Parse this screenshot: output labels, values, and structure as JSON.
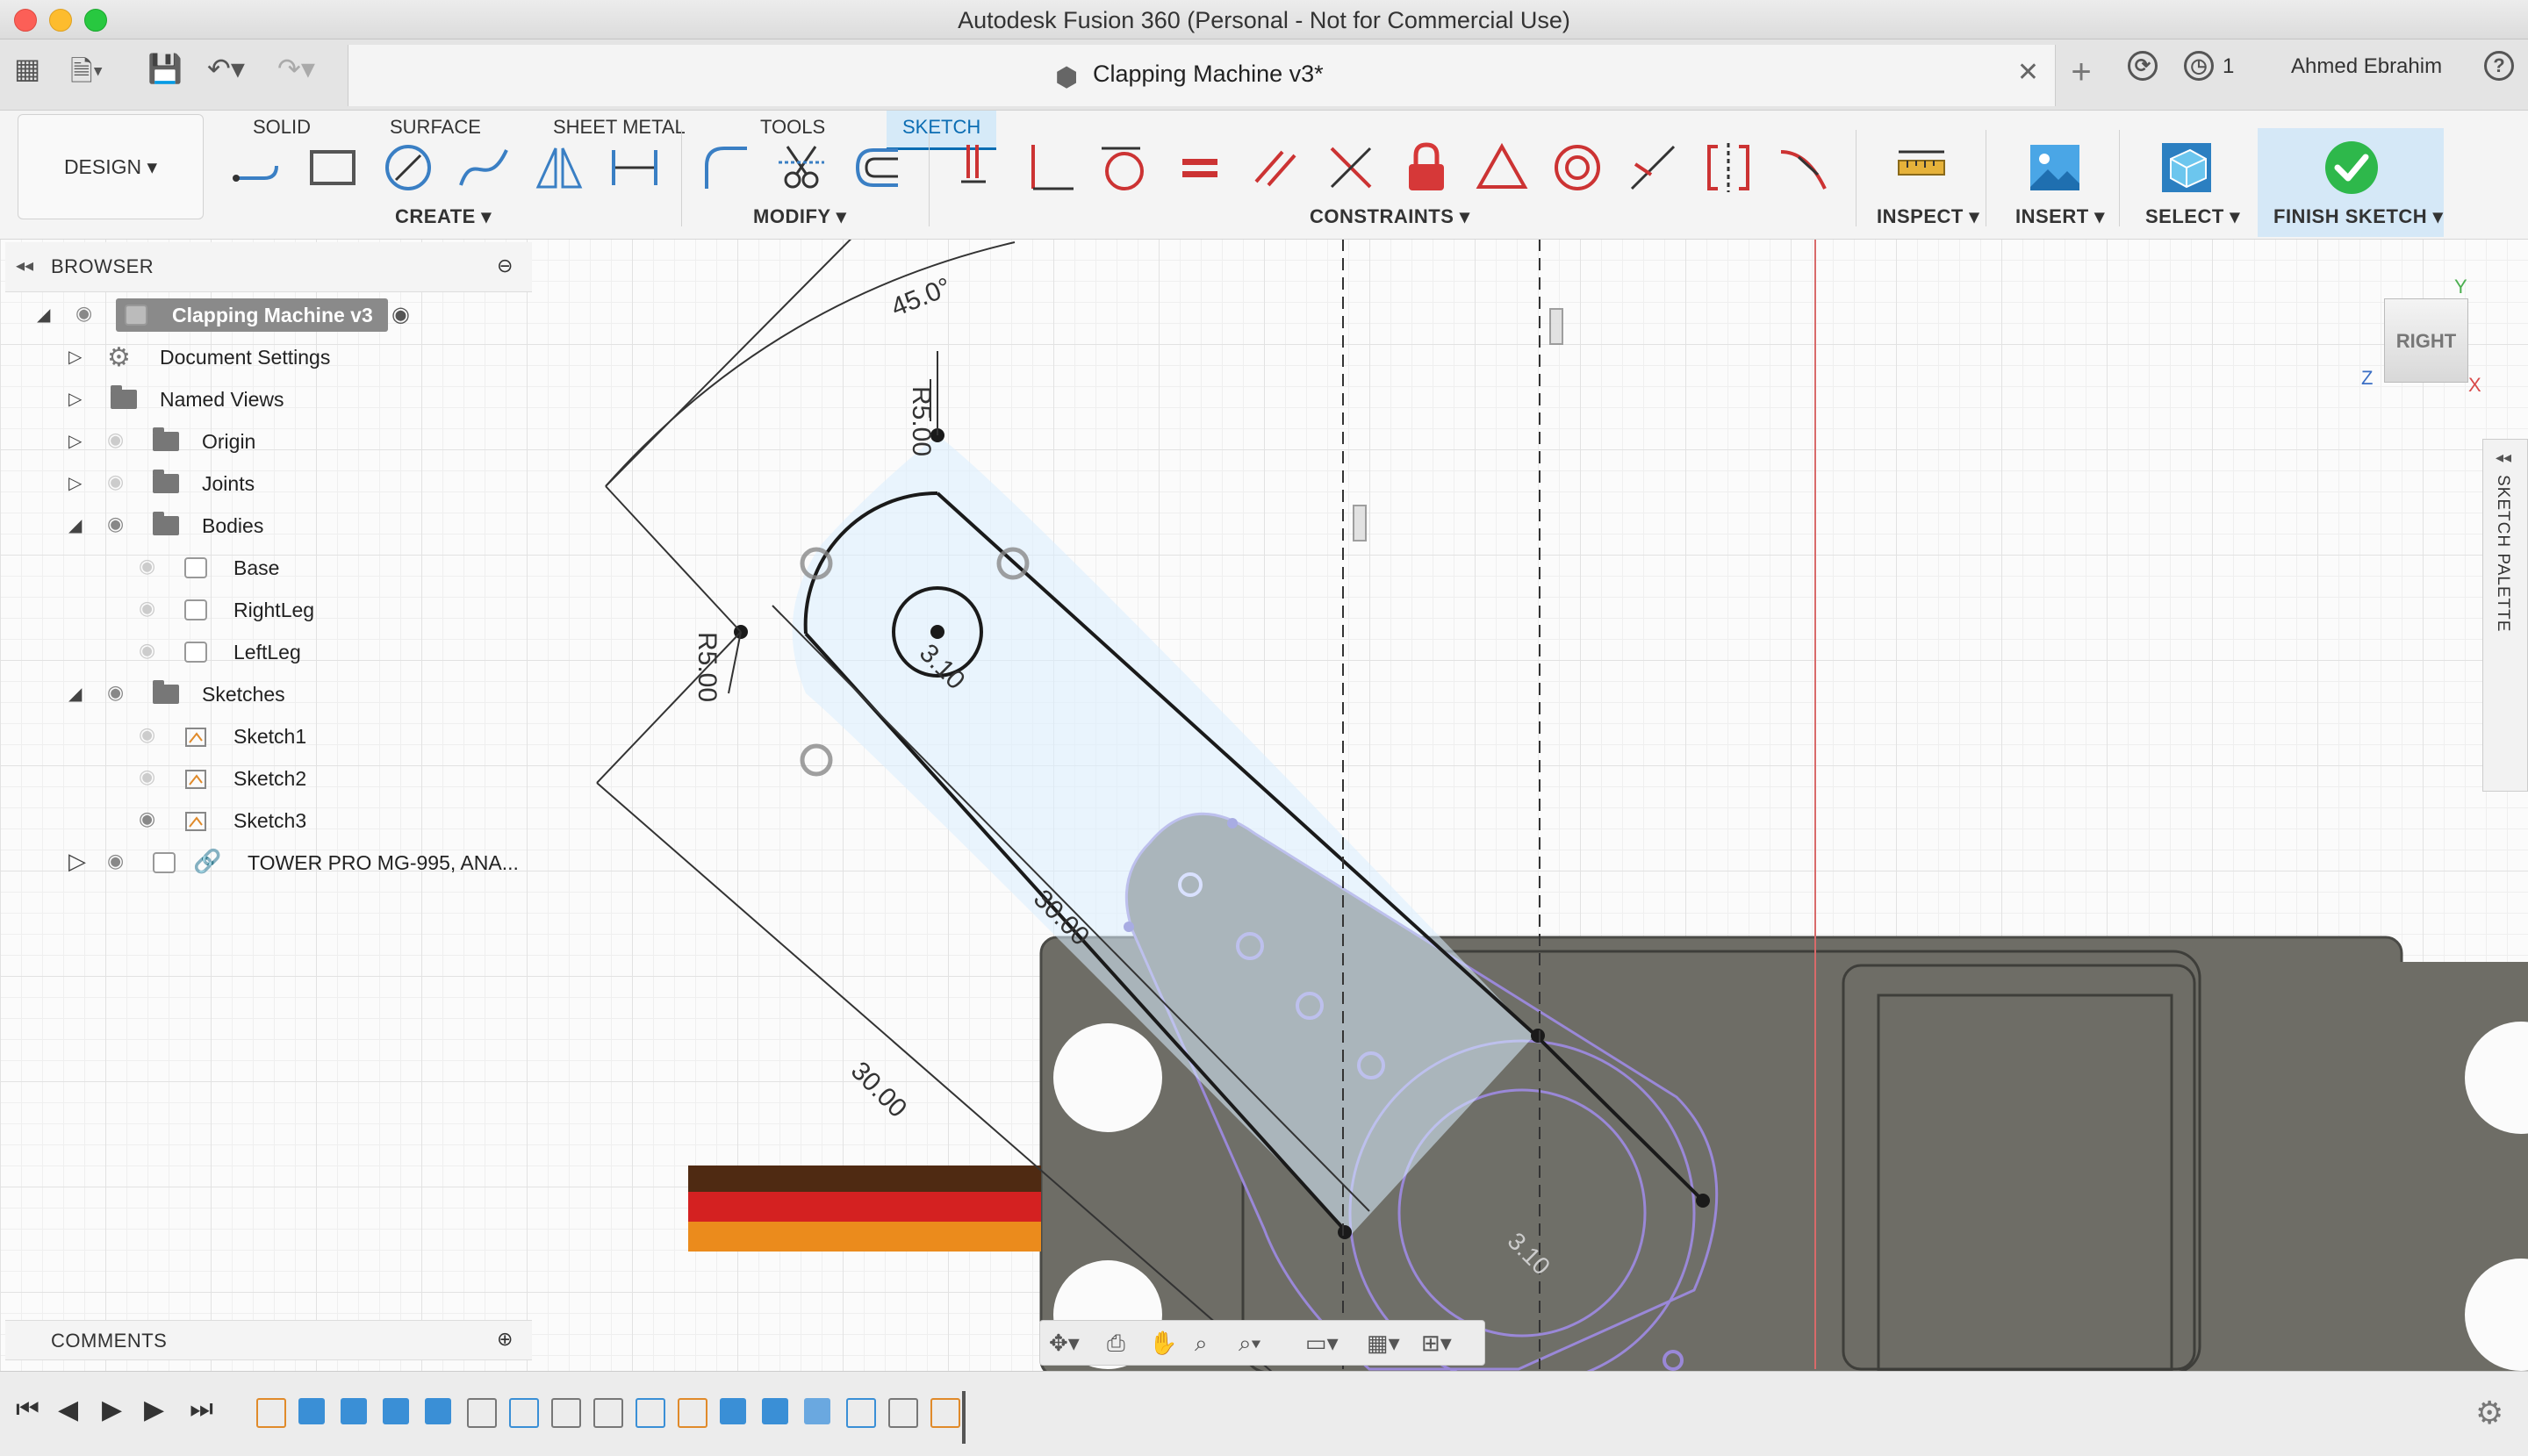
{
  "window": {
    "title": "Autodesk Fusion 360 (Personal - Not for Commercial Use)"
  },
  "tab": {
    "title": "Clapping Machine v3*",
    "job_count": "1",
    "user": "Ahmed Ebrahim"
  },
  "toolbar": {
    "design_label": "DESIGN ▾",
    "workspace_tabs": [
      "SOLID",
      "SURFACE",
      "SHEET METAL",
      "TOOLS",
      "SKETCH"
    ],
    "active_tab": "SKETCH",
    "groups": {
      "create": "CREATE ▾",
      "modify": "MODIFY ▾",
      "constraints": "CONSTRAINTS ▾",
      "inspect": "INSPECT ▾",
      "insert": "INSERT ▾",
      "select": "SELECT ▾",
      "finish": "FINISH SKETCH ▾"
    }
  },
  "browser": {
    "title": "BROWSER",
    "items": [
      {
        "label": "Clapping Machine v3"
      },
      {
        "label": "Document Settings"
      },
      {
        "label": "Named Views"
      },
      {
        "label": "Origin"
      },
      {
        "label": "Joints"
      },
      {
        "label": "Bodies"
      },
      {
        "label": "Base"
      },
      {
        "label": "RightLeg"
      },
      {
        "label": "LeftLeg"
      },
      {
        "label": "Sketches"
      },
      {
        "label": "Sketch1"
      },
      {
        "label": "Sketch2"
      },
      {
        "label": "Sketch3"
      },
      {
        "label": "TOWER PRO MG-995, ANA..."
      }
    ]
  },
  "comments": {
    "title": "COMMENTS"
  },
  "canvas": {
    "dimensions": {
      "angle": "45.0°",
      "radius_top": "R5.00",
      "radius_left": "R5.00",
      "hole": "3.10",
      "length_inner": "30.00",
      "length_outer": "30.00",
      "shaft": "3.10"
    },
    "viewcube": "RIGHT",
    "axis": {
      "y": "Y",
      "z": "Z",
      "x": "X"
    },
    "sketch_palette": "SKETCH PALETTE"
  },
  "colors": {
    "accent": "#0b6db3",
    "finish_check": "#2eb84b",
    "lock": "#d63838",
    "sketch_fill": "#dbeeff"
  }
}
